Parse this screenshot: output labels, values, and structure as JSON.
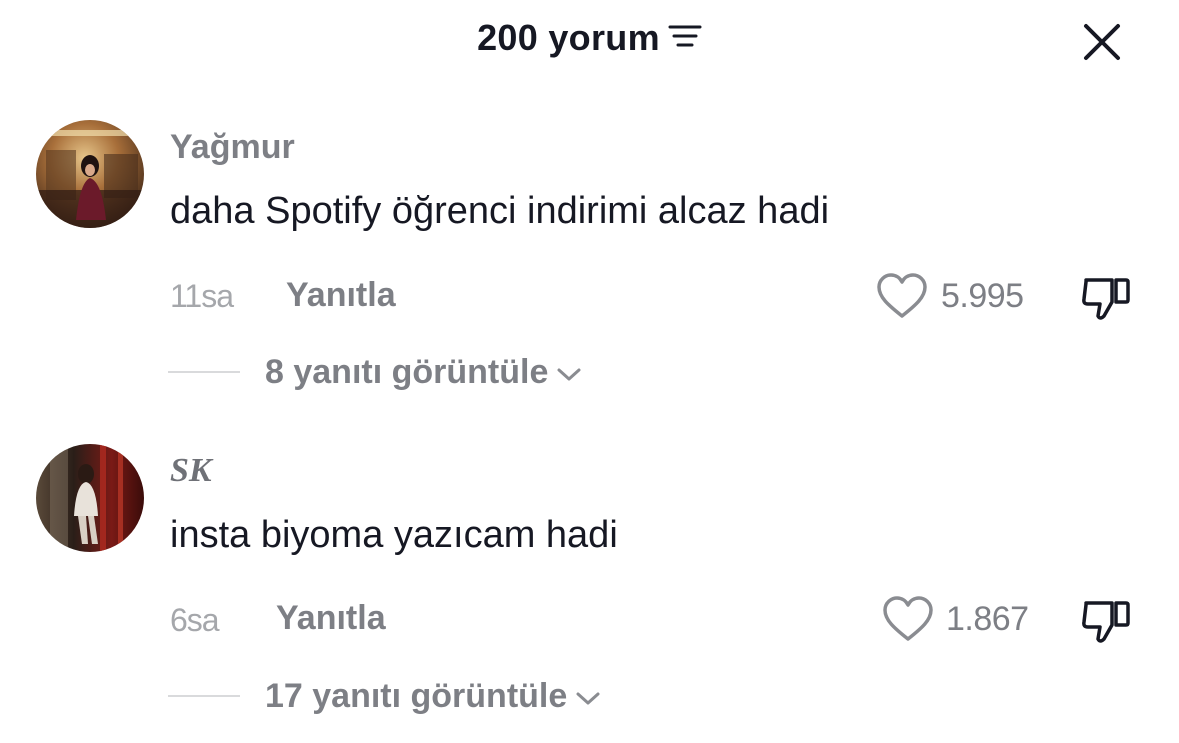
{
  "header": {
    "title": "200 yorum",
    "sort_icon": "sort-lines-icon",
    "close_icon": "close-icon"
  },
  "comments": [
    {
      "username": "Yağmur",
      "text": "daha Spotify öğrenci indirimi alcaz hadi",
      "time": "11sa",
      "reply_label": "Yanıtla",
      "likes": "5.995",
      "view_replies": "8 yanıtı görüntüle"
    },
    {
      "username": "SK",
      "text": "insta biyoma yazıcam hadi",
      "time": "6sa",
      "reply_label": "Yanıtla",
      "likes": "1.867",
      "view_replies": "17 yanıtı görüntüle"
    }
  ],
  "colors": {
    "primary_text": "#161823",
    "secondary_text": "#7d7f85",
    "tertiary_text": "#a5a7ab",
    "divider": "#d9dadc"
  }
}
